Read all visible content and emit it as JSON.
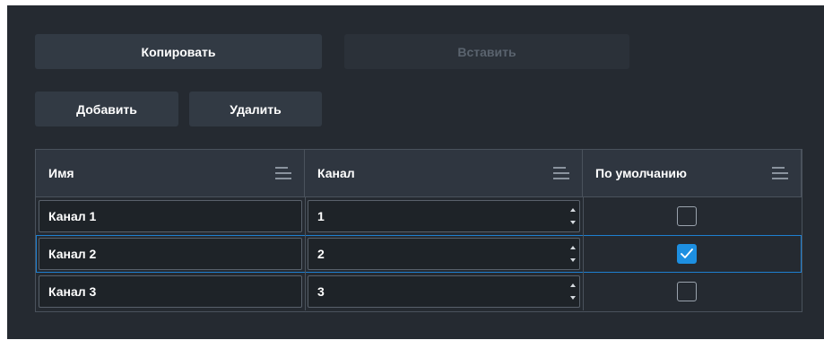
{
  "toolbar": {
    "copy_label": "Копировать",
    "paste_label": "Вставить",
    "add_label": "Добавить",
    "delete_label": "Удалить"
  },
  "table": {
    "columns": [
      {
        "label": "Имя"
      },
      {
        "label": "Канал"
      },
      {
        "label": "По умолчанию"
      }
    ],
    "rows": [
      {
        "name": "Канал 1",
        "channel": "1",
        "default": false,
        "selected": false
      },
      {
        "name": "Канал 2",
        "channel": "2",
        "default": true,
        "selected": true
      },
      {
        "name": "Канал 3",
        "channel": "3",
        "default": false,
        "selected": false
      }
    ]
  },
  "colors": {
    "panel_bg": "#252a31",
    "accent": "#1d8fe1",
    "selection_border": "#1e7fd0"
  },
  "icons": {
    "column_menu": "hamburger-lines-icon",
    "spinner": "up-down-arrows-icon",
    "check": "checkmark-icon"
  }
}
